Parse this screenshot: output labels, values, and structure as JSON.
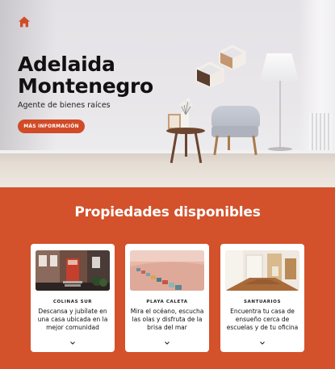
{
  "hero": {
    "home_icon": "home-icon",
    "title_line1": "Adelaida",
    "title_line2": "Montenegro",
    "subtitle": "Agente de bienes raíces",
    "button_label": "MÁS INFORMACIÓN"
  },
  "properties": {
    "title": "Propiedades disponibles",
    "cards": [
      {
        "label": "COLINAS SUR",
        "description": "Descansa y jubílate en una casa ubicada en la mejor comunidad",
        "icon": "chevron-down-icon"
      },
      {
        "label": "PLAYA CALETA",
        "description": "Mira el océano, escucha las olas y disfruta de la brisa del mar",
        "icon": "chevron-down-icon"
      },
      {
        "label": "SANTUARIOS",
        "description": "Encuentra tu casa de ensueño cerca de escuelas y de tu oficina",
        "icon": "chevron-down-icon"
      }
    ]
  },
  "colors": {
    "accent": "#d14b27",
    "section_background": "#d3512b",
    "card_background": "#ffffff"
  }
}
